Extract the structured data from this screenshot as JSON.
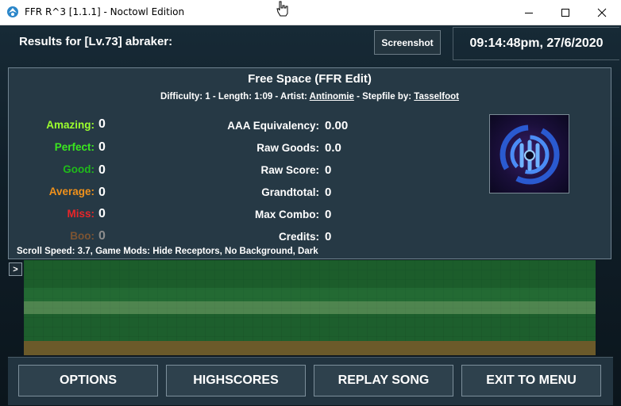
{
  "window": {
    "title": "FFR R^3 [1.1.1] - Noctowl Edition",
    "icon": "ffr-app-icon",
    "controls": [
      "minimize-icon",
      "maximize-icon",
      "close-icon"
    ]
  },
  "header": {
    "results_title": "Results for [Lv.73] abraker:",
    "screenshot_label": "Screenshot",
    "datetime": "09:14:48pm, 27/6/2020"
  },
  "song": {
    "title": "Free Space (FFR Edit)",
    "difficulty_prefix": "Difficulty: 1 - Length: 1:09 - Artist: ",
    "artist": "Antinomie",
    "stepfile_prefix": " - Stepfile by: ",
    "stepfile_author": "Tasselfoot"
  },
  "judgements": [
    {
      "label": "Amazing:",
      "value": "0",
      "color": "#9cff2e"
    },
    {
      "label": "Perfect:",
      "value": "0",
      "color": "#3be81f"
    },
    {
      "label": "Good:",
      "value": "0",
      "color": "#1fbb1a"
    },
    {
      "label": "Average:",
      "value": "0",
      "color": "#f0911b"
    },
    {
      "label": "Miss:",
      "value": "0",
      "color": "#e8262a"
    },
    {
      "label": "Boo:",
      "value": "0",
      "color": "#7d5432"
    }
  ],
  "stats": [
    {
      "label": "AAA Equivalency:",
      "value": "0.00"
    },
    {
      "label": "Raw Goods:",
      "value": "0.0"
    },
    {
      "label": "Raw Score:",
      "value": "0"
    },
    {
      "label": "Grandtotal:",
      "value": "0"
    },
    {
      "label": "Max Combo:",
      "value": "0"
    },
    {
      "label": "Credits:",
      "value": "0"
    }
  ],
  "mods": "Scroll Speed: 3.7, Game Mods: Hide Receptors, No Background, Dark",
  "graph": {
    "expand_label": ">"
  },
  "menu": {
    "options": "OPTIONS",
    "highscores": "HIGHSCORES",
    "replay": "REPLAY SONG",
    "exit": "EXIT TO MENU"
  },
  "colors": {
    "panel_bg": "#263945",
    "graph_green": "#1d5a2c",
    "graph_gold": "#6b5a2a"
  }
}
